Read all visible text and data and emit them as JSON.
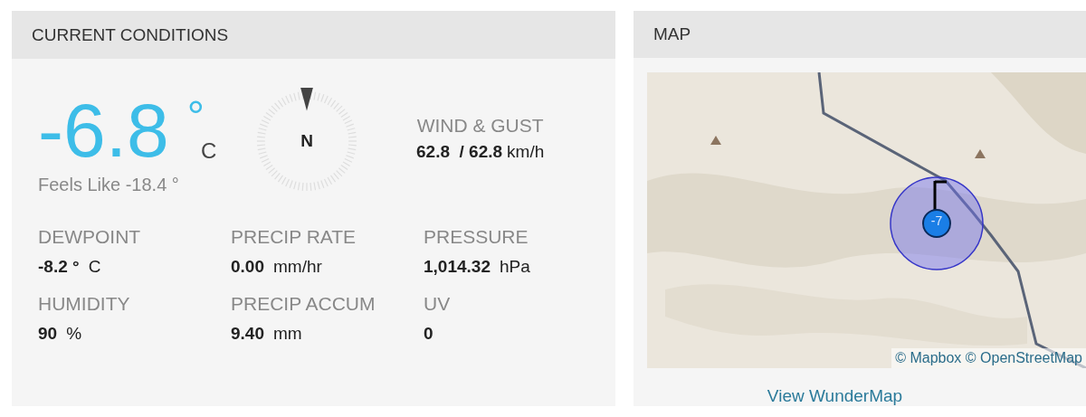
{
  "conditions": {
    "title": "CURRENT CONDITIONS",
    "temperature": "-6.8",
    "degree": "°",
    "unit": "C",
    "feels_like": "Feels Like -18.4 °",
    "compass": {
      "direction": "N"
    },
    "wind": {
      "label": "WIND & GUST",
      "value": "62.8  / 62.8",
      "unit": "km/h"
    },
    "stats": [
      {
        "label": "DEWPOINT",
        "value": "-8.2 °",
        "unit": "C"
      },
      {
        "label": "PRECIP RATE",
        "value": "0.00",
        "unit": "mm/hr"
      },
      {
        "label": "PRESSURE",
        "value": "1,014.32",
        "unit": "hPa"
      },
      {
        "label": "HUMIDITY",
        "value": "90",
        "unit": "%"
      },
      {
        "label": "PRECIP ACCUM",
        "value": "9.40",
        "unit": "mm"
      },
      {
        "label": "UV",
        "value": "0"
      }
    ]
  },
  "map": {
    "title": "MAP",
    "marker": "-7",
    "attribution": "© Mapbox © OpenStreetMap",
    "link": "View WunderMap"
  }
}
